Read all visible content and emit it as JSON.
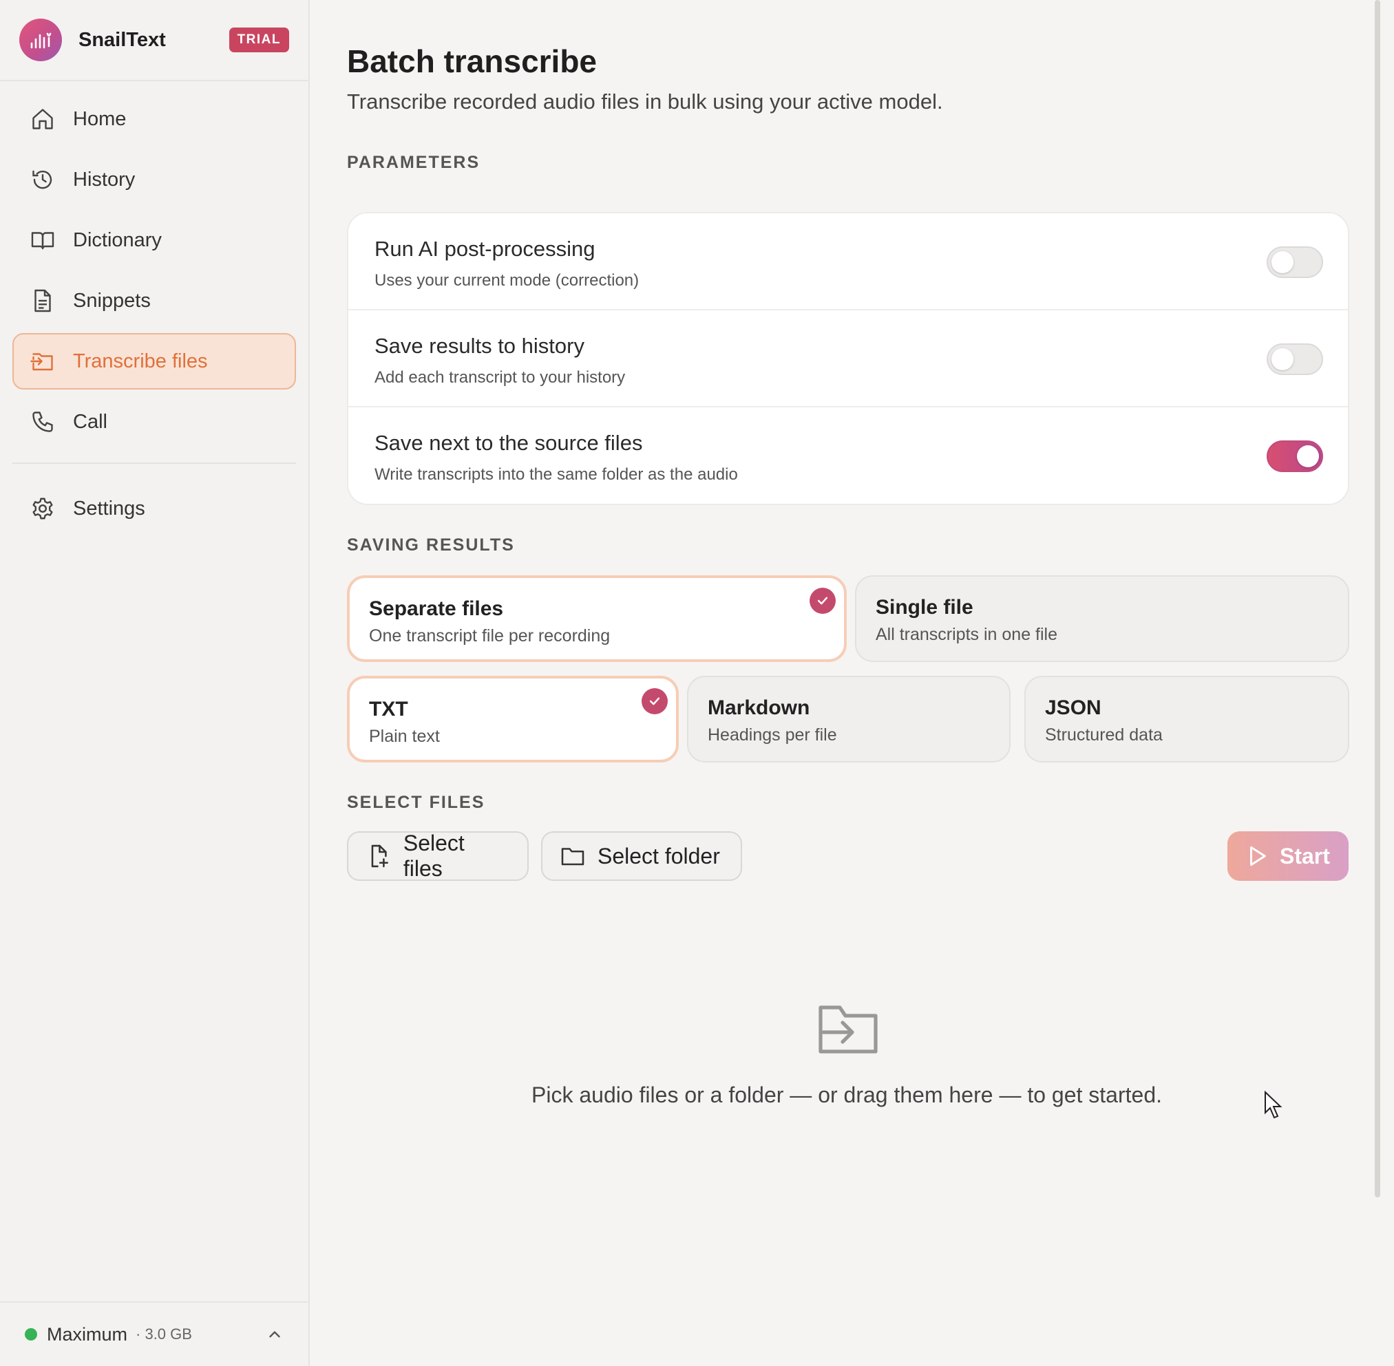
{
  "app": {
    "name": "SnailText",
    "badge": "TRIAL"
  },
  "sidebar": {
    "items": [
      {
        "label": "Home",
        "icon": "home-icon",
        "active": false
      },
      {
        "label": "History",
        "icon": "history-icon",
        "active": false
      },
      {
        "label": "Dictionary",
        "icon": "book-icon",
        "active": false
      },
      {
        "label": "Snippets",
        "icon": "document-icon",
        "active": false
      },
      {
        "label": "Transcribe files",
        "icon": "file-import-icon",
        "active": true
      },
      {
        "label": "Call",
        "icon": "phone-icon",
        "active": false
      }
    ],
    "settings": {
      "label": "Settings",
      "icon": "gear-icon"
    },
    "footer": {
      "model": "Maximum",
      "size": "· 3.0 GB",
      "status_color": "#37b257"
    }
  },
  "main": {
    "title": "Batch transcribe",
    "subtitle": "Transcribe recorded audio files in bulk using your active model.",
    "parameters": {
      "label": "PARAMETERS",
      "rows": [
        {
          "title": "Run AI post-processing",
          "desc": "Uses your current mode (correction)",
          "on": false
        },
        {
          "title": "Save results to history",
          "desc": "Add each transcript to your history",
          "on": false
        },
        {
          "title": "Save next to the source files",
          "desc": "Write transcripts into the same folder as the audio",
          "on": true
        }
      ]
    },
    "saving": {
      "label": "SAVING RESULTS",
      "modes": [
        {
          "title": "Separate files",
          "desc": "One transcript file per recording",
          "selected": true
        },
        {
          "title": "Single file",
          "desc": "All transcripts in one file",
          "selected": false
        }
      ],
      "formats": [
        {
          "title": "TXT",
          "desc": "Plain text",
          "selected": true
        },
        {
          "title": "Markdown",
          "desc": "Headings per file",
          "selected": false
        },
        {
          "title": "JSON",
          "desc": "Structured data",
          "selected": false
        }
      ]
    },
    "select": {
      "label": "SELECT FILES",
      "files_button": "Select files",
      "folder_button": "Select folder",
      "start_button": "Start"
    },
    "empty_state": "Pick audio files or a folder — or drag them here — to get started."
  },
  "colors": {
    "accent": "#e0703a",
    "brand": "#c9455f",
    "toggle_on": "#c24b7c"
  }
}
